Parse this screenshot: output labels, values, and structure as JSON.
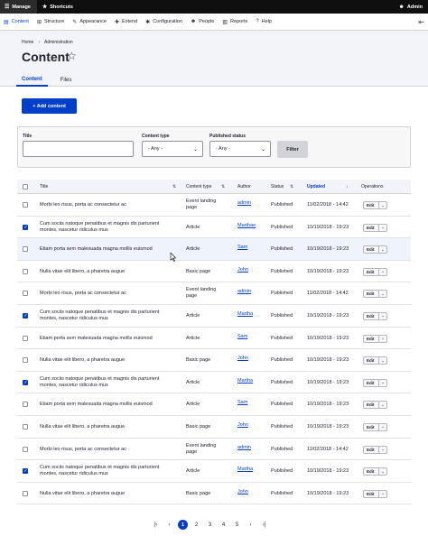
{
  "toolbar": {
    "manage": "Manage",
    "shortcuts": "Shortcuts",
    "user": "Admin"
  },
  "menu": [
    {
      "icon": "content-icon",
      "glyph": "▤",
      "label": "Content",
      "active": true
    },
    {
      "icon": "structure-icon",
      "glyph": "⊞",
      "label": "Structure"
    },
    {
      "icon": "appearance-icon",
      "glyph": "✎",
      "label": "Appearance"
    },
    {
      "icon": "extend-icon",
      "glyph": "✚",
      "label": "Extend"
    },
    {
      "icon": "configuration-icon",
      "glyph": "✱",
      "label": "Configuration"
    },
    {
      "icon": "people-icon",
      "glyph": "☻",
      "label": "People"
    },
    {
      "icon": "reports-icon",
      "glyph": "▥",
      "label": "Reports"
    },
    {
      "icon": "help-icon",
      "glyph": "?",
      "label": "Help"
    }
  ],
  "breadcrumb": {
    "home": "Home",
    "admin": "Administration"
  },
  "page": {
    "title": "Content"
  },
  "tabs": {
    "content": "Content",
    "files": "Files"
  },
  "actions": {
    "add": "+ Add content"
  },
  "filters": {
    "title_label": "Title",
    "title_value": "",
    "type_label": "Content type",
    "type_value": "- Any -",
    "status_label": "Published status",
    "status_value": "- Any -",
    "submit": "Filter"
  },
  "columns": {
    "title": "Title",
    "type": "Content type",
    "author": "Author",
    "status": "Status",
    "updated": "Updated",
    "operations": "Operations"
  },
  "rows": [
    {
      "checked": false,
      "title": "Morbi leo risus, porta ac consectetur ac",
      "type": "Event landing page",
      "author": "admin",
      "status": "Published",
      "updated": "11/02/2018 - 14:42"
    },
    {
      "checked": true,
      "title": "Cum sociis natoque penatibus et magnis dis parturient montes, nascetur ridiculus mus",
      "type": "Article",
      "author": "Marthae",
      "status": "Published",
      "updated": "10/19/2018 - 19:23"
    },
    {
      "checked": false,
      "title": "Etiam porta sem malesuada magna mollis euismod",
      "type": "Article",
      "author": "Sam",
      "status": "Published",
      "updated": "10/19/2018 - 19:23"
    },
    {
      "checked": false,
      "title": "Nulla vitae elit libero, a pharetra augue",
      "type": "Basic page",
      "author": "John",
      "status": "Published",
      "updated": "10/19/2018 - 19:23"
    },
    {
      "checked": false,
      "title": "Morbi leo risus, porta ac consectetur ac",
      "type": "Event landing page",
      "author": "admin",
      "status": "Published",
      "updated": "11/02/2018 - 14:42"
    },
    {
      "checked": true,
      "title": "Cum sociis natoque penatibus et magnis dis parturient montes, nascetur ridiculus mus",
      "type": "Article",
      "author": "Martha",
      "status": "Published",
      "updated": "10/19/2018 - 19:23"
    },
    {
      "checked": false,
      "title": "Etiam porta sem malesuada magna mollis euismod",
      "type": "Article",
      "author": "Sam",
      "status": "Published",
      "updated": "10/19/2018 - 19:23"
    },
    {
      "checked": false,
      "title": "Nulla vitae elit libero, a pharetra augue",
      "type": "Basic page",
      "author": "John",
      "status": "Published",
      "updated": "10/19/2018 - 19:23"
    },
    {
      "checked": true,
      "title": "Cum sociis natoque penatibus et magnis dis parturient montes, nascetur ridiculus mus",
      "type": "Article",
      "author": "Martha",
      "status": "Published",
      "updated": "10/19/2018 - 19:23"
    },
    {
      "checked": false,
      "title": "Etiam porta sem malesuada magna mollis euismod",
      "type": "Article",
      "author": "Sam",
      "status": "Published",
      "updated": "10/19/2018 - 19:23"
    },
    {
      "checked": false,
      "title": "Nulla vitae elit libero, a pharetra augue",
      "type": "Basic page",
      "author": "John",
      "status": "Published",
      "updated": "10/19/2018 - 19:23"
    },
    {
      "checked": false,
      "title": "Morbi leo risus, porta ac consectetur ac",
      "type": "Event landing page",
      "author": "admin",
      "status": "Published",
      "updated": "11/02/2018 - 14:42"
    },
    {
      "checked": true,
      "title": "Cum sociis natoque penatibus et magnis dis parturient montes, nascetur ridiculus mus",
      "type": "Article",
      "author": "Martha",
      "status": "Published",
      "updated": "10/19/2018 - 19:23"
    },
    {
      "checked": false,
      "title": "Nulla vitae elit libero, a pharetra augue",
      "type": "Basic page",
      "author": "John",
      "status": "Published",
      "updated": "10/19/2018 - 19:23"
    }
  ],
  "hovered_row": 2,
  "row_ops": {
    "edit": "Edit"
  },
  "pager": {
    "first": "|‹",
    "prev": "‹",
    "pages": [
      "1",
      "2",
      "3",
      "4",
      "5"
    ],
    "current": "1",
    "next": "›",
    "last": "›|"
  },
  "colors": {
    "accent": "#003ecc",
    "toolbar": "#0f0f0f",
    "header_bg": "#f3f4f9"
  }
}
